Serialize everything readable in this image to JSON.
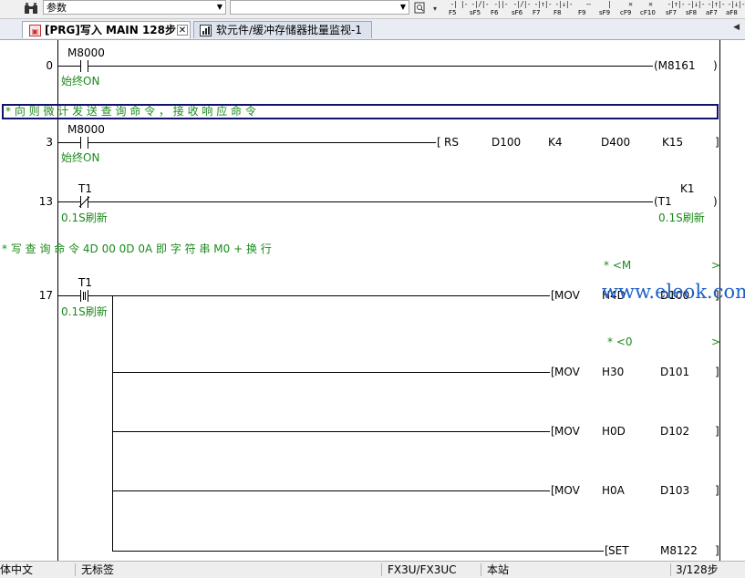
{
  "toolbar": {
    "device_combo_value": "参数",
    "icons": [
      "binoculars-icon",
      "search-icon"
    ],
    "fkeys": [
      {
        "sym": "-| |-",
        "label": "F5"
      },
      {
        "sym": "-|/|-",
        "label": "sF5"
      },
      {
        "sym": "-||-",
        "label": "F6"
      },
      {
        "sym": "-|/|-",
        "label": "sF6"
      },
      {
        "sym": "-|↑|-",
        "label": "F7"
      },
      {
        "sym": "-|↓|-",
        "label": "F8"
      },
      {
        "sym": "—",
        "label": "F9"
      },
      {
        "sym": "|",
        "label": "sF9"
      },
      {
        "sym": "✕",
        "label": "cF9"
      },
      {
        "sym": "✕",
        "label": "cF10"
      },
      {
        "sym": "-|↑|-",
        "label": "sF7"
      },
      {
        "sym": "-|↓|-",
        "label": "sF8"
      },
      {
        "sym": "-|↑|-",
        "label": "aF7"
      },
      {
        "sym": "-|↓|-",
        "label": "aF8"
      }
    ]
  },
  "tabs": [
    {
      "label": "[PRG]写入 MAIN 128步",
      "active": true
    },
    {
      "label": "软元件/缓冲存储器批量监视-1",
      "active": false
    }
  ],
  "ladder": {
    "rungs": [
      {
        "step": "0",
        "contact": "M8000",
        "contact_comment": "始终ON",
        "coil": "(M8161",
        "coil_end": ")"
      },
      {
        "step": "3",
        "contact": "M8000",
        "contact_comment": "始终ON",
        "instr": "RS",
        "operands": [
          "D100",
          "K4",
          "D400",
          "K15"
        ],
        "end": "]"
      },
      {
        "step": "13",
        "contact": "T1",
        "contact_comment": "0.1S刷新",
        "coil": "(T1",
        "coil_const": "K1",
        "coil_comment": "0.1S刷新",
        "coil_end": ")"
      },
      {
        "step": "17",
        "contact": "T1",
        "contact_comment": "0.1S刷新"
      }
    ],
    "comment_box": "* 向 则 微 计 发 送 查 询 命 令 ， 接 收 响 应 命 令",
    "comment_line": "* 写 查 询 命 令 4D  00  0D  0A   即 字 符 串  M0 +  换 行",
    "branches": [
      {
        "instr": "MOV",
        "src": "H4D",
        "dst": "D100",
        "note_left": "* <M",
        "note_right": ">",
        "end": "]"
      },
      {
        "instr": "MOV",
        "src": "H30",
        "dst": "D101",
        "note_left": "* <0",
        "note_right": ">",
        "end": "]"
      },
      {
        "instr": "MOV",
        "src": "H0D",
        "dst": "D102",
        "end": "]"
      },
      {
        "instr": "MOV",
        "src": "H0A",
        "dst": "D103",
        "end": "]"
      },
      {
        "instr": "SET",
        "src": "",
        "dst": "M8122",
        "end": "]"
      }
    ],
    "watermark": "www.eleok.com"
  },
  "statusbar": {
    "cells": [
      "简体中文",
      "无标签",
      "FX3U/FX3UC",
      "本站",
      "3/128步"
    ]
  },
  "colors": {
    "comment": "#1c8a1c",
    "selection_box": "#12126e",
    "watermark": "#2060c8"
  }
}
